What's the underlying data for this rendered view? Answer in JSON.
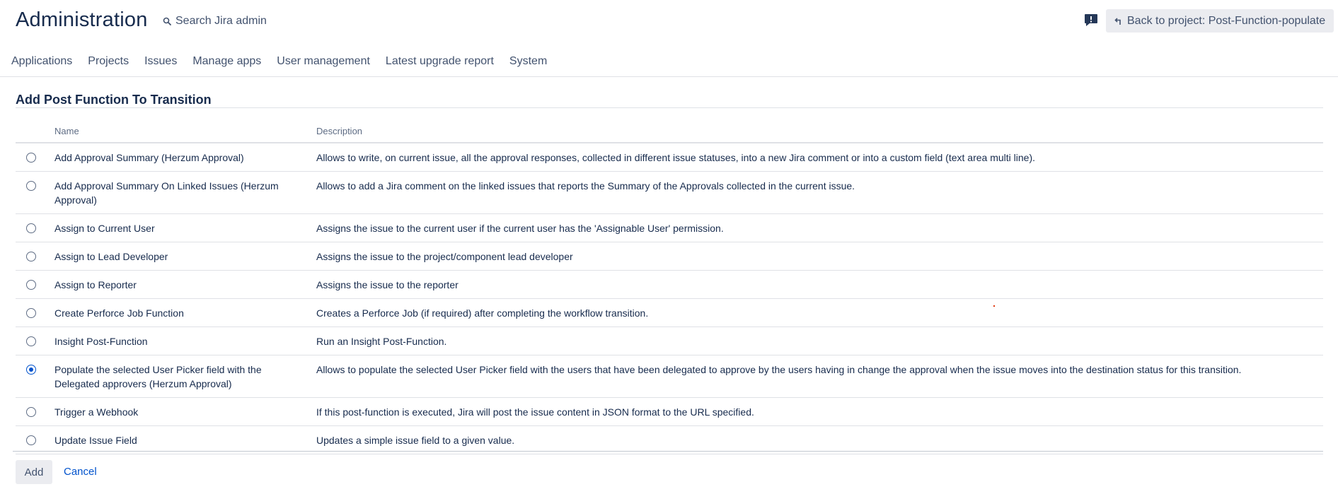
{
  "header": {
    "title": "Administration",
    "search_placeholder": "Search Jira admin",
    "back_button_label": "Back to project: Post-Function-populate"
  },
  "nav": {
    "items": [
      "Applications",
      "Projects",
      "Issues",
      "Manage apps",
      "User management",
      "Latest upgrade report",
      "System"
    ]
  },
  "section": {
    "title": "Add Post Function To Transition"
  },
  "table": {
    "columns": [
      "Name",
      "Description"
    ],
    "rows": [
      {
        "name": "Add Approval Summary (Herzum Approval)",
        "description": "Allows to write, on current issue, all the approval responses, collected in different issue statuses, into a new Jira comment or into a custom field (text area multi line).",
        "selected": false
      },
      {
        "name": "Add Approval Summary On Linked Issues (Herzum Approval)",
        "description": "Allows to add a Jira comment on the linked issues that reports the Summary of the Approvals collected in the current issue.",
        "selected": false
      },
      {
        "name": "Assign to Current User",
        "description": "Assigns the issue to the current user if the current user has the 'Assignable User' permission.",
        "selected": false
      },
      {
        "name": "Assign to Lead Developer",
        "description": "Assigns the issue to the project/component lead developer",
        "selected": false
      },
      {
        "name": "Assign to Reporter",
        "description": "Assigns the issue to the reporter",
        "selected": false
      },
      {
        "name": "Create Perforce Job Function",
        "description": "Creates a Perforce Job (if required) after completing the workflow transition.",
        "selected": false
      },
      {
        "name": "Insight Post-Function",
        "description": "Run an Insight Post-Function.",
        "selected": false
      },
      {
        "name": "Populate the selected User Picker field with the Delegated approvers (Herzum Approval)",
        "description": "Allows to populate the selected User Picker field with the users that have been delegated to approve by the users having in change the approval when the issue moves into the destination status for this transition.",
        "selected": true
      },
      {
        "name": "Trigger a Webhook",
        "description": "If this post-function is executed, Jira will post the issue content in JSON format to the URL specified.",
        "selected": false
      },
      {
        "name": "Update Issue Field",
        "description": "Updates a simple issue field to a given value.",
        "selected": false
      }
    ]
  },
  "actions": {
    "add_label": "Add",
    "cancel_label": "Cancel"
  },
  "icons": {
    "search": "search-icon",
    "feedback": "feedback-icon",
    "back": "back-arrow-icon",
    "radio": "radio-button"
  },
  "colors": {
    "accent": "#0052cc",
    "text": "#172b4d",
    "muted": "#42526e",
    "button_bg": "#ebecf0",
    "divider": "#dfe1e6"
  }
}
